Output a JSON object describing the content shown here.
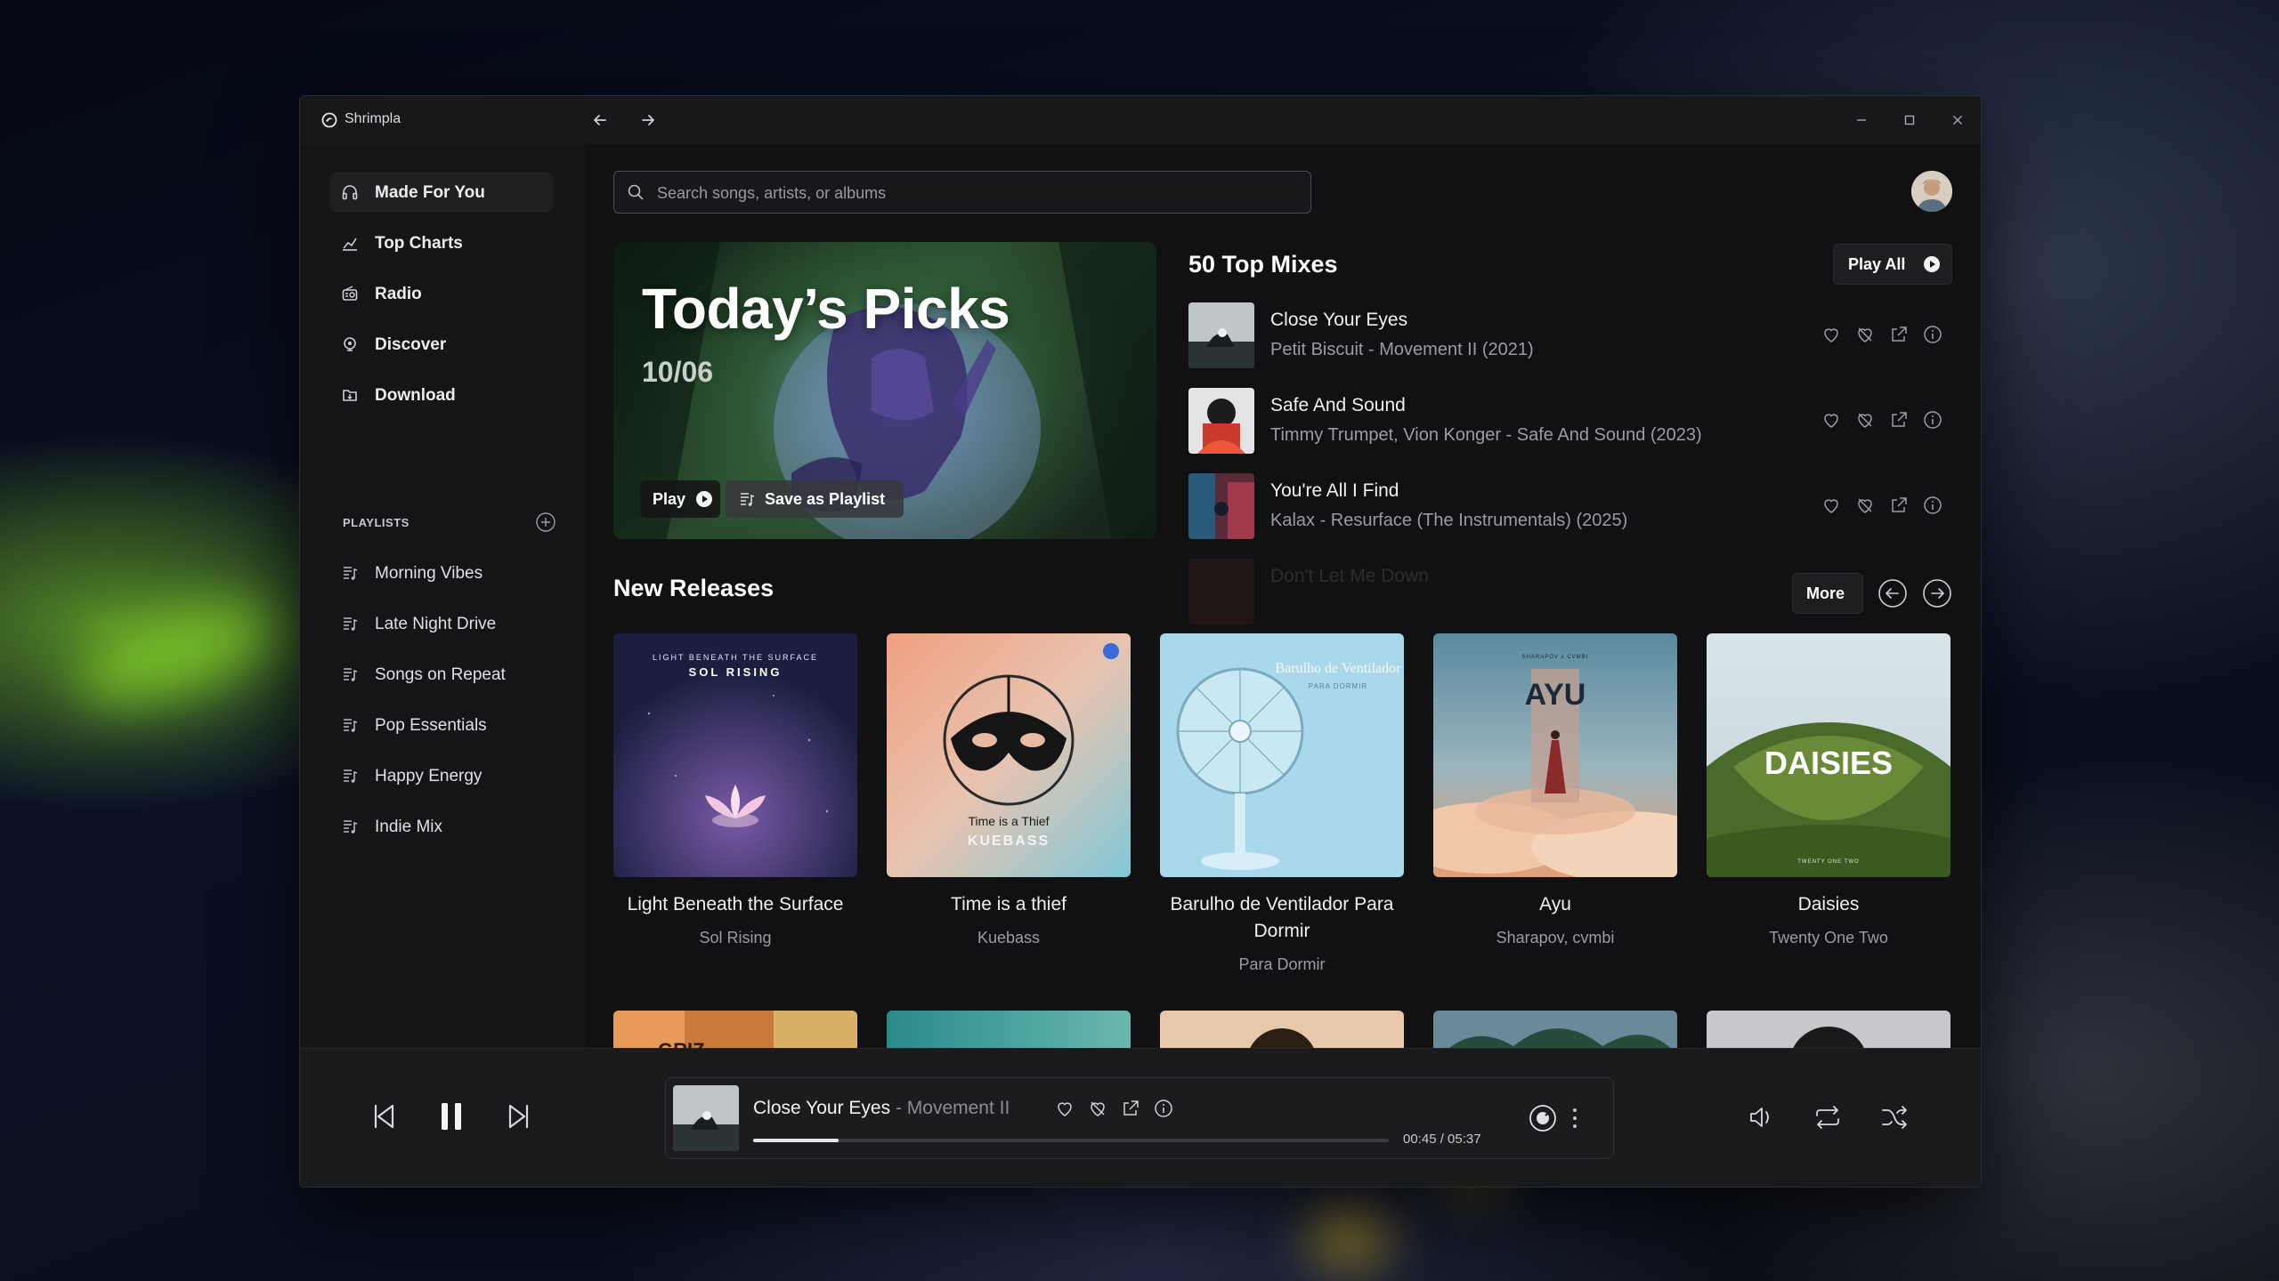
{
  "app": {
    "name": "Shrimpla"
  },
  "search": {
    "placeholder": "Search songs, artists, or albums"
  },
  "sidebar": {
    "nav": [
      {
        "label": "Made For You",
        "icon": "headphones-icon"
      },
      {
        "label": "Top Charts",
        "icon": "chart-icon"
      },
      {
        "label": "Radio",
        "icon": "radio-icon"
      },
      {
        "label": "Discover",
        "icon": "discover-icon"
      },
      {
        "label": "Download",
        "icon": "download-icon"
      }
    ],
    "playlists_header": "PLAYLISTS",
    "playlists": [
      {
        "label": "Morning Vibes"
      },
      {
        "label": "Late Night Drive"
      },
      {
        "label": "Songs on Repeat"
      },
      {
        "label": "Pop Essentials"
      },
      {
        "label": "Happy Energy"
      },
      {
        "label": "Indie Mix"
      }
    ]
  },
  "hero": {
    "title": "Today’s Picks",
    "date": "10/06",
    "play_label": "Play",
    "save_label": "Save as Playlist"
  },
  "top_mixes": {
    "title": "50 Top Mixes",
    "play_all_label": "Play All",
    "tracks": [
      {
        "name": "Close Your Eyes",
        "sub": "Petit Biscuit - Movement II (2021)"
      },
      {
        "name": "Safe And Sound",
        "sub": "Timmy Trumpet, Vion Konger - Safe And Sound (2023)"
      },
      {
        "name": "You're All I Find",
        "sub": "Kalax - Resurface (The Instrumentals) (2025)"
      },
      {
        "name": "Don't Let Me Down",
        "sub": ""
      }
    ]
  },
  "new_releases": {
    "title": "New Releases",
    "more_label": "More",
    "albums": [
      {
        "title": "Light Beneath the Surface",
        "artist": "Sol Rising",
        "cover_line1": "LIGHT BENEATH THE SURFACE",
        "cover_line2": "SOL RISING"
      },
      {
        "title": "Time is a thief",
        "artist": "Kuebass",
        "cover_line1": "Time is a Thief",
        "cover_line2": "KUEBASS"
      },
      {
        "title": "Barulho de Ventilador Para Dormir",
        "artist": "Para Dormir",
        "cover_line1": "Barulho de Ventilador",
        "cover_line2": "PARA DORMIR"
      },
      {
        "title": "Ayu",
        "artist": "Sharapov, cvmbi",
        "cover_line1": "AYU",
        "cover_line2": "SHARAPOV x CVMBI"
      },
      {
        "title": "Daisies",
        "artist": "Twenty One Two",
        "cover_line1": "DAISIES",
        "cover_line2": "TWENTY ONE TWO"
      }
    ],
    "peek_label": "GRIZ"
  },
  "player": {
    "title": "Close Your Eyes",
    "separator": " - ",
    "album": "Movement II",
    "time": "00:45 / 05:37",
    "progress": 0.134
  },
  "colors": {
    "accent": "#ffffff",
    "window_bg": "#121214",
    "sidebar_bg": "#151517",
    "player_bg": "#1a1a1c"
  }
}
